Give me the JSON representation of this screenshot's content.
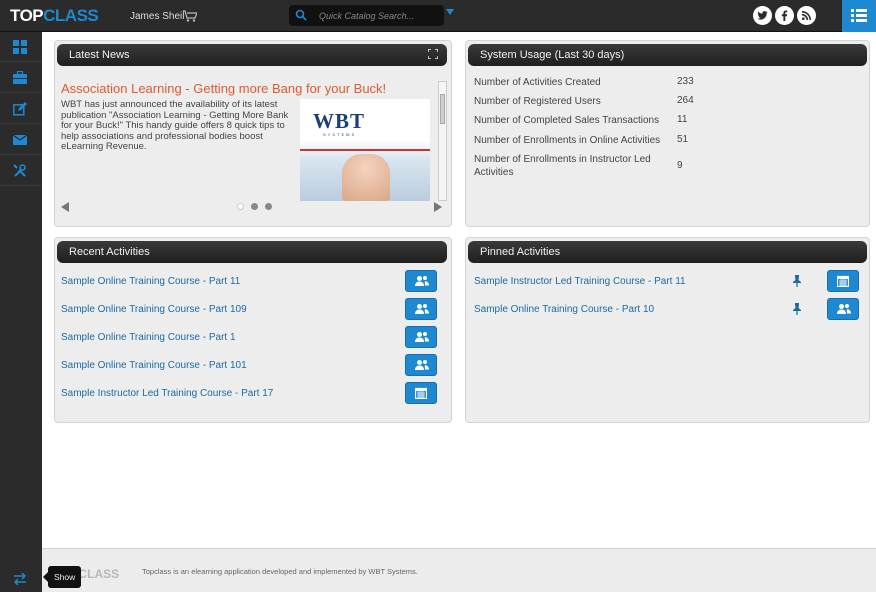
{
  "header": {
    "logo_part1": "TOP",
    "logo_part2": "CLASS",
    "user_name": "James Sheil",
    "search_placeholder": "Quick Catalog Search...",
    "social": [
      "twitter-icon",
      "facebook-icon",
      "rss-icon"
    ],
    "menu_icon": "list-menu-icon"
  },
  "sidebar": {
    "items": [
      "dashboard-icon",
      "briefcase-icon",
      "edit-icon",
      "envelope-icon",
      "tools-icon"
    ],
    "bottom_icon": "swap-arrows-icon"
  },
  "news": {
    "heading": "Latest News",
    "title": "Association Learning - Getting more Bang for your Buck!",
    "body": "WBT has just announced the availability of its latest publication \"Association Learning - Getting More Bank for your Buck!\" This handy guide offers 8 quick tips to help associations and professional bodies boost eLearning Revenue.",
    "image_logo": "WBT",
    "image_sub": "SYSTEMS",
    "slide_count": 3,
    "active_slide": 1
  },
  "usage": {
    "heading": "System Usage (Last 30 days)",
    "rows": [
      {
        "label": "Number of Activities Created",
        "value": "233"
      },
      {
        "label": "Number of Registered Users",
        "value": "264"
      },
      {
        "label": "Number of Completed Sales Transactions",
        "value": "11"
      },
      {
        "label": "Number of Enrollments in Online Activities",
        "value": "51"
      },
      {
        "label": "Number of Enrollments in Instructor Led Activities",
        "value": "9"
      }
    ]
  },
  "recent": {
    "heading": "Recent Activities",
    "items": [
      {
        "label": "Sample Online Training Course - Part 11",
        "icon": "users-icon"
      },
      {
        "label": "Sample Online Training Course - Part 109",
        "icon": "users-icon"
      },
      {
        "label": "Sample Online Training Course - Part 1",
        "icon": "users-icon"
      },
      {
        "label": "Sample Online Training Course - Part 101",
        "icon": "users-icon"
      },
      {
        "label": "Sample Instructor Led Training Course - Part 17",
        "icon": "calendar-icon"
      }
    ]
  },
  "pinned": {
    "heading": "Pinned Activities",
    "items": [
      {
        "label": "Sample Instructor Led Training Course - Part 11",
        "icon": "calendar-icon"
      },
      {
        "label": "Sample Online Training Course - Part 10",
        "icon": "users-icon"
      }
    ]
  },
  "footer": {
    "logo": "TOPCLASS",
    "text": "Topclass is an elearning application developed and implemented by WBT Systems.",
    "tooltip": "Show"
  },
  "colors": {
    "accent": "#1e88d0",
    "news_title": "#e0592f",
    "link": "#1c6aa5",
    "bar": "#2b2b2b"
  }
}
